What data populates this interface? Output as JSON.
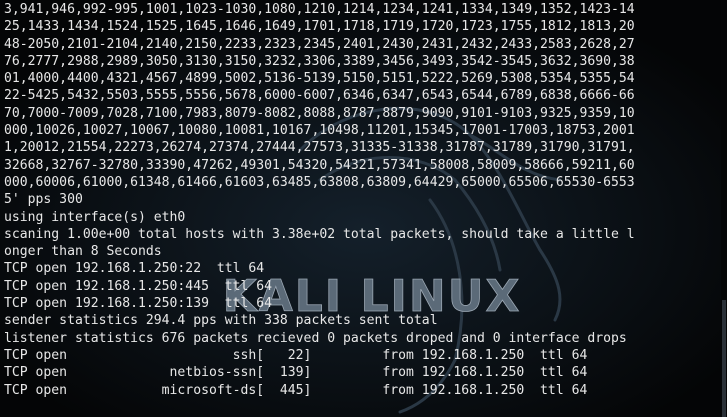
{
  "terminal": {
    "wallpaper_text": "KALI LINUX",
    "colors": {
      "background": "#040506",
      "text": "#e8e8e8",
      "logo": "#5b6a78"
    },
    "lines": [
      "3,941,946,992-995,1001,1023-1030,1080,1210,1214,1234,1241,1334,1349,1352,1423-14",
      "25,1433,1434,1524,1525,1645,1646,1649,1701,1718,1719,1720,1723,1755,1812,1813,20",
      "48-2050,2101-2104,2140,2150,2233,2323,2345,2401,2430,2431,2432,2433,2583,2628,27",
      "76,2777,2988,2989,3050,3130,3150,3232,3306,3389,3456,3493,3542-3545,3632,3690,38",
      "01,4000,4400,4321,4567,4899,5002,5136-5139,5150,5151,5222,5269,5308,5354,5355,54",
      "22-5425,5432,5503,5555,5556,5678,6000-6007,6346,6347,6543,6544,6789,6838,6666-66",
      "70,7000-7009,7028,7100,7983,8079-8082,8088,8787,8879,9090,9101-9103,9325,9359,10",
      "000,10026,10027,10067,10080,10081,10167,10498,11201,15345,17001-17003,18753,2001",
      "1,20012,21554,22273,26274,27374,27444,27573,31335-31338,31787,31789,31790,31791,",
      "32668,32767-32780,33390,47262,49301,54320,54321,57341,58008,58009,58666,59211,60",
      "000,60006,61000,61348,61466,61603,63485,63808,63809,64429,65000,65506,65530-6553",
      "5' pps 300",
      "using interface(s) eth0",
      "scaning 1.00e+00 total hosts with 3.38e+02 total packets, should take a little l",
      "onger than 8 Seconds",
      "TCP open 192.168.1.250:22  ttl 64",
      "TCP open 192.168.1.250:445  ttl 64",
      "TCP open 192.168.1.250:139  ttl 64",
      "sender statistics 294.4 pps with 338 packets sent total",
      "listener statistics 676 packets recieved 0 packets droped and 0 interface drops",
      "TCP open                     ssh[   22]         from 192.168.1.250  ttl 64",
      "TCP open             netbios-ssn[  139]         from 192.168.1.250  ttl 64",
      "TCP open            microsoft-ds[  445]         from 192.168.1.250  ttl 64"
    ]
  }
}
